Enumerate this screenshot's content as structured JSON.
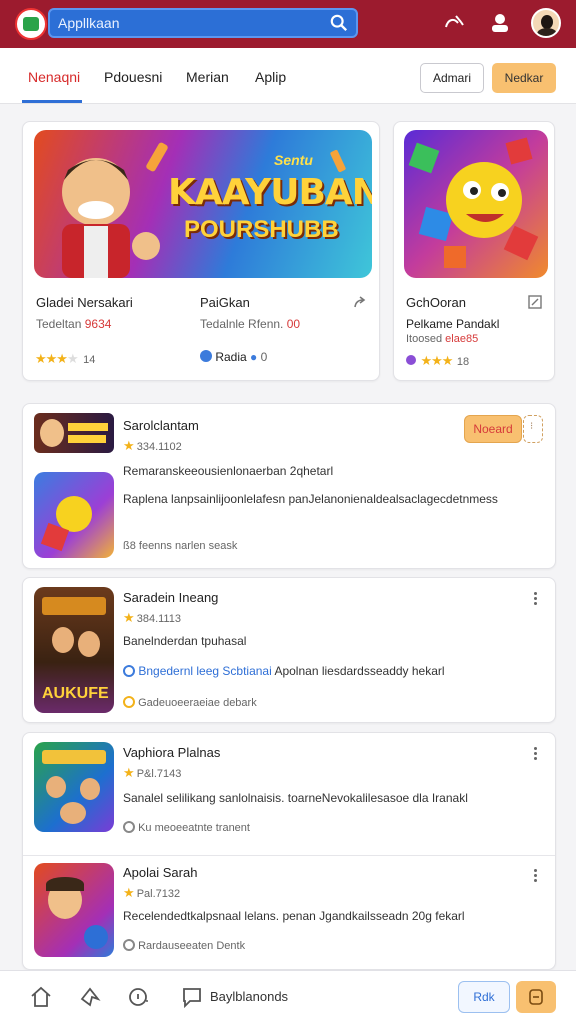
{
  "topbar": {
    "search_placeholder": "Appllkaan",
    "icons": [
      "app-logo-icon",
      "search-icon",
      "share-icon",
      "user-icon",
      "profile-avatar"
    ]
  },
  "tabs": {
    "items": [
      "Nenaqni",
      "Pdouesni",
      "Merian",
      "Aplip"
    ],
    "active_index": 0,
    "btn_outline": "Admari",
    "btn_primary": "Nedkar"
  },
  "featured": {
    "banner_title_top": "Sentu",
    "banner_title_main": "KAAYUBAN",
    "banner_title_sub": "POURSHUBB",
    "left": {
      "col1_title": "Gladei Nersakari",
      "col1_sub_prefix": "Tedeltan",
      "col1_sub_red": "9634",
      "col1_stars": 3,
      "col1_count": "14",
      "col2_title": "PaiGkan",
      "col2_sub_prefix": "Tedalnle Rfenn.",
      "col2_sub_red": "00",
      "col2_meta": "Radia",
      "col2_count": "0"
    },
    "right": {
      "title": "GchOoran",
      "sub1": "Pelkame Pandakl",
      "sub2_prefix": "Itoosed",
      "sub2_red": "elae85",
      "stars": 3,
      "count": "18"
    }
  },
  "list": [
    {
      "title": "Sarolclantam",
      "rating": "334.1102",
      "desc1": "Remaranskeeousienlonaerban 2qhetarl",
      "desc2": "Raplena lanpsainlijoonlelafesn panJelanonienaldealsaclagecdetnmess",
      "foot": "ß8 feenns narlen seask",
      "action": "Noeard"
    },
    {
      "title": "Saradein Ineang",
      "rating": "384.1113",
      "desc1": "Banelnderdan tpuhasal",
      "desc2_blue": "Bngedernl leeg Scbtianai",
      "desc2": "Apolnan liesdardsseaddy hekarl",
      "foot": "Gadeuoeeraeiae debark"
    },
    {
      "title": "Vaphiora Plalnas",
      "rating": "P&l.7143",
      "desc1": "Sanalel selilikang sanlolnaisis. toarneNevokalilesasoe dla Iranakl",
      "foot": "Ku meoeeatnte tranent"
    },
    {
      "title": "Apolai Sarah",
      "rating": "Pal.7132",
      "desc1": "Recelendedtkalpsnaal lelans. penan Jgandkailsseadn 20g fekarl",
      "foot": "Rardauseeaten Dentk"
    }
  ],
  "bottombar": {
    "label": "Baylblanonds",
    "btn_outline": "Rdk"
  }
}
